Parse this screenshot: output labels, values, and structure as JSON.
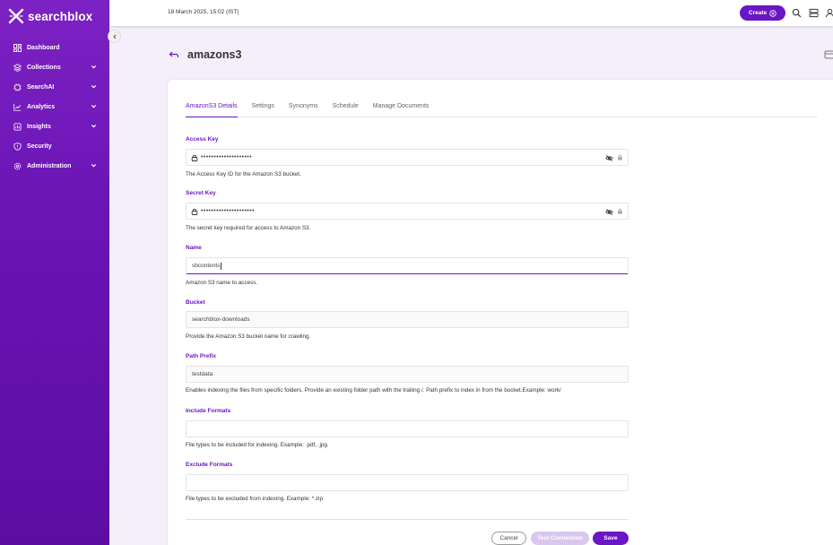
{
  "app": {
    "logo_text": "searchblox"
  },
  "sidebar": {
    "items": [
      {
        "label": "Dashboard",
        "icon": "dashboard-icon",
        "has_chevron": false
      },
      {
        "label": "Collections",
        "icon": "layers-icon",
        "has_chevron": true
      },
      {
        "label": "SearchAI",
        "icon": "ai-chip-icon",
        "has_chevron": true
      },
      {
        "label": "Analytics",
        "icon": "chart-icon",
        "has_chevron": true
      },
      {
        "label": "Insights",
        "icon": "insights-icon",
        "has_chevron": true
      },
      {
        "label": "Security",
        "icon": "shield-icon",
        "has_chevron": false
      },
      {
        "label": "Administration",
        "icon": "gear-icon",
        "has_chevron": true
      }
    ]
  },
  "topbar": {
    "date": "18 March 2025, 15:02 (IST)",
    "create_label": "Create"
  },
  "page": {
    "title": "amazons3"
  },
  "tabs": [
    {
      "label": "AmazonS3 Details",
      "active": true
    },
    {
      "label": "Settings",
      "active": false
    },
    {
      "label": "Synonyms",
      "active": false
    },
    {
      "label": "Schedule",
      "active": false
    },
    {
      "label": "Manage Documents",
      "active": false
    }
  ],
  "form": {
    "access_key": {
      "label": "Access Key",
      "value": "••••••••••••••••••••",
      "help": "The Access Key ID for the Amazon S3 bucket."
    },
    "secret_key": {
      "label": "Secret Key",
      "value": "•••••••••••••••••••••",
      "help": "The secret key required for access to Amazon S3."
    },
    "name": {
      "label": "Name",
      "value": "sbcontents",
      "help": "Amazon S3 name to access."
    },
    "bucket": {
      "label": "Bucket",
      "value": "searchblox-downloads",
      "help": "Provide the Amazon S3 bucket name for crawling."
    },
    "path_prefix": {
      "label": "Path Prefix",
      "value": "testdata",
      "help": "Enables indexing the files from specific folders. Provide an existing folder path with the trailing /. Path prefix to index in from the bucket.Example: work/"
    },
    "include_formats": {
      "label": "Include Formats",
      "value": "",
      "help": "File types to be included for indexing. Example: .pdf, .jpg."
    },
    "exclude_formats": {
      "label": "Exclude Formats",
      "value": "",
      "help": "File types to be excluded from indexing. Example: *.zip"
    }
  },
  "buttons": {
    "cancel": "Cancel",
    "test_connection": "Test Connection",
    "save": "Save"
  },
  "colors": {
    "brand": "#6a16c4",
    "sidebar_top": "#7d22c4",
    "disabled": "#d9c7ee"
  }
}
